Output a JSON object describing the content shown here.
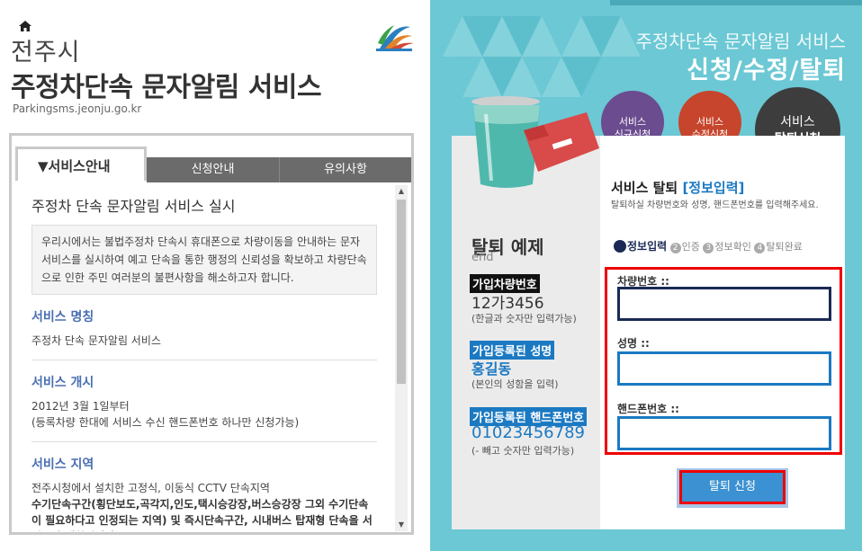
{
  "header": {
    "city": "전주시",
    "title": "주정차단속 문자알림 서비스",
    "url": "Parkingsms.jeonju.go.kr"
  },
  "tabs": [
    {
      "label": "▼서비스안내"
    },
    {
      "label": "신청안내"
    },
    {
      "label": "유의사항"
    }
  ],
  "content": {
    "heading": "주정차 단속 문자알림 서비스 실시",
    "intro": "우리시에서는 불법주정차 단속시 휴대폰으로 차량이동을 안내하는 문자서비스를 실시하여 예고 단속을 통한 행정의 신뢰성을 확보하고 차량단속으로 인한 주민 여러분의 불편사항을 해소하고자 합니다.",
    "sections": [
      {
        "title": "서비스 명칭",
        "lines": [
          "주정차 단속 문자알림 서비스"
        ]
      },
      {
        "title": "서비스 개시",
        "lines": [
          "2012년 3월 1일부터",
          "(등록차량 한대에 서비스 수신 핸드폰번호 하나만 신청가능)"
        ]
      },
      {
        "title": "서비스 지역",
        "lines": [
          "전주시청에서 설치한 고정식, 이동식 CCTV 단속지역"
        ],
        "bold_lines": [
          "수기단속구간(횡단보도,곡각지,인도,택시승강장,버스승강장 그외 수기단속이 필요하다고 인정되는 지역) 및 즉시단속구간, 시내버스 탑재형 단속을 서비스가 제한됩니다."
        ]
      }
    ]
  },
  "right": {
    "subtitle": "주정차단속 문자알림 서비스",
    "title": "신청/수정/탈퇴",
    "circles": {
      "new": [
        "서비스",
        "신규신청"
      ],
      "edit": [
        "서비스",
        "수정신청"
      ],
      "quit": [
        "서비스",
        "탈퇴신청"
      ]
    },
    "example": {
      "title": "탈퇴 예제",
      "end": "end",
      "car_label": "가입차량번호",
      "car_value": "12가3456",
      "car_hint": "(한글과 숫자만 입력가능)",
      "name_label": "가입등록된 성명",
      "name_value": "홍길동",
      "name_hint": "(본인의 성함을 입력)",
      "phone_label": "가입등록된 핸드폰번호",
      "phone_value": "01023456789",
      "phone_hint": "(- 빼고 숫자만 입력가능)"
    },
    "form": {
      "title_prefix": "서비스 탈퇴 ",
      "title_highlight": "[정보입력]",
      "desc": "탈퇴하실 차량번호와 성명, 핸드폰번호를 입력해주세요.",
      "steps": [
        {
          "n": "1",
          "label": "정보입력"
        },
        {
          "n": "2",
          "label": "인증"
        },
        {
          "n": "3",
          "label": "정보확인"
        },
        {
          "n": "4",
          "label": "탈퇴완료"
        }
      ],
      "car_label": "차량번호 ::",
      "name_label": "성명 ::",
      "phone_label": "핸드폰번호 ::",
      "car_value": "",
      "name_value": "",
      "phone_value": "",
      "submit": "탈퇴 신청"
    }
  },
  "colors": {
    "panel_bg": "#6bc8d4",
    "accent_blue": "#1b79c2",
    "highlight_red": "#ee0000",
    "purple": "#6b4c8f",
    "orange": "#c6452c",
    "dark": "#3d3d3d"
  }
}
